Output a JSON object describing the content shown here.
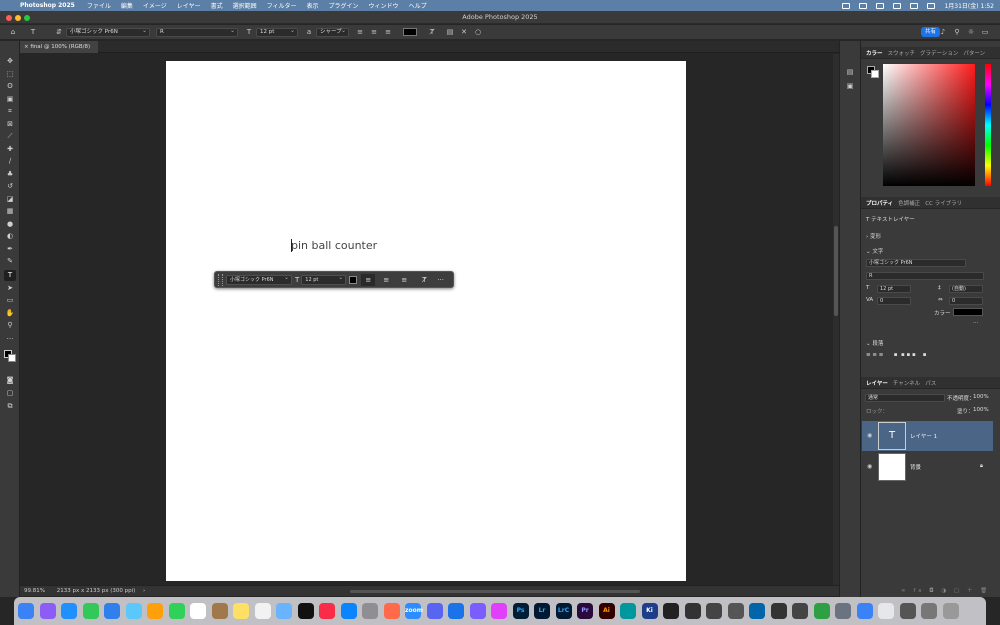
{
  "menubar": {
    "app_name": "Photoshop 2025",
    "items": [
      "ファイル",
      "編集",
      "イメージ",
      "レイヤー",
      "書式",
      "選択範囲",
      "フィルター",
      "表示",
      "プラグイン",
      "ウィンドウ",
      "ヘルプ"
    ],
    "clock": "1月31日(金)  1:52"
  },
  "window": {
    "title": "Adobe Photoshop 2025"
  },
  "options_bar": {
    "font_family": "小塚ゴシック Pr6N",
    "font_style": "R",
    "font_size": "12 pt",
    "antialias": "シャープ",
    "text_color": "#000000",
    "share_label": "共有"
  },
  "document": {
    "tab_label": "final @ 100% (RGB/8)",
    "text": "pin ball counter"
  },
  "context_bar": {
    "font_family": "小塚ゴシック Pr6N",
    "font_size": "12 pt",
    "more": "···"
  },
  "status": {
    "zoom": "99.81%",
    "doc_info": "2133 px x 2133 px (300 ppi)"
  },
  "color_panel": {
    "tabs": [
      "カラー",
      "スウォッチ",
      "グラデーション",
      "パターン"
    ]
  },
  "properties": {
    "tabs": [
      "プロパティ",
      "色調補正",
      "CC ライブラリ"
    ],
    "kind": "テキストレイヤー",
    "transform_label": "変形",
    "character_label": "文字",
    "font_family": "小塚ゴシック Pr6N",
    "font_style": "R",
    "font_size": "12 pt",
    "leading": "(自動)",
    "kerning": "0",
    "tracking": "0",
    "color_label": "カラー",
    "more": "···",
    "paragraph_label": "段落"
  },
  "layers_panel": {
    "tabs": [
      "レイヤー",
      "チャンネル",
      "パス"
    ],
    "blend_mode": "通常",
    "opacity_label": "不透明度：",
    "opacity": "100%",
    "lock_label": "ロック：",
    "fill_label": "塗り：",
    "fill": "100%",
    "layers": [
      {
        "name": "レイヤー 1",
        "type": "text",
        "thumb": "T"
      },
      {
        "name": "背景",
        "type": "background",
        "thumb": ""
      }
    ]
  },
  "dock": {
    "labels": [
      "Ps",
      "Lr",
      "LrC",
      "Pr",
      "Ai",
      "Ki",
      "zoom"
    ]
  }
}
